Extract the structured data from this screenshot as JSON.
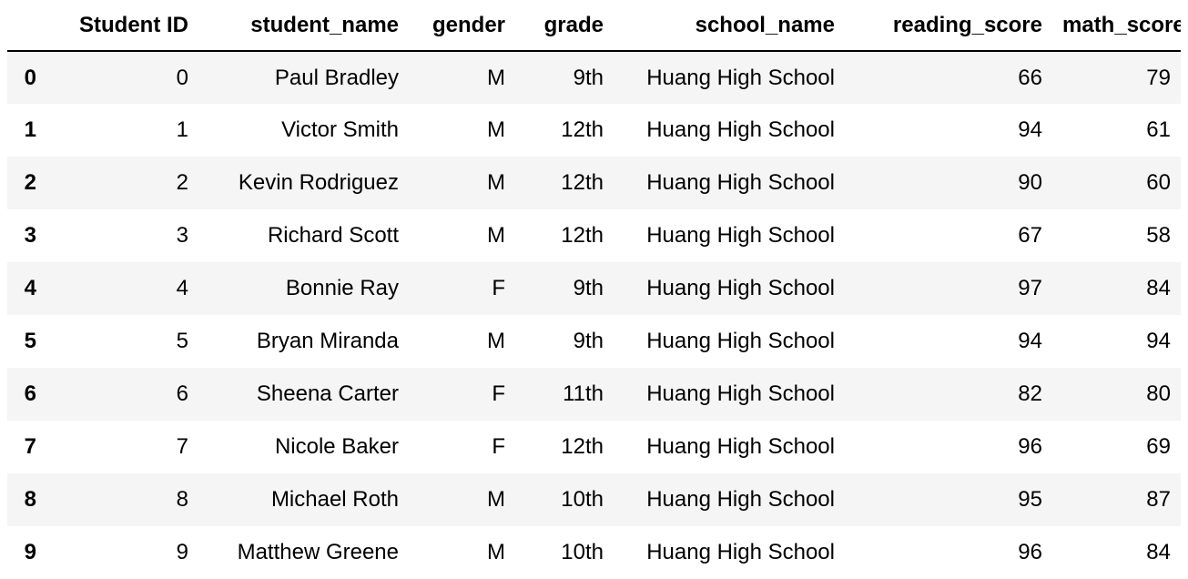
{
  "table": {
    "columns": [
      "",
      "Student ID",
      "student_name",
      "gender",
      "grade",
      "school_name",
      "reading_score",
      "math_score"
    ],
    "rows": [
      {
        "index": "0",
        "cells": [
          "0",
          "Paul Bradley",
          "M",
          "9th",
          "Huang High School",
          "66",
          "79"
        ]
      },
      {
        "index": "1",
        "cells": [
          "1",
          "Victor Smith",
          "M",
          "12th",
          "Huang High School",
          "94",
          "61"
        ]
      },
      {
        "index": "2",
        "cells": [
          "2",
          "Kevin Rodriguez",
          "M",
          "12th",
          "Huang High School",
          "90",
          "60"
        ]
      },
      {
        "index": "3",
        "cells": [
          "3",
          "Richard Scott",
          "M",
          "12th",
          "Huang High School",
          "67",
          "58"
        ]
      },
      {
        "index": "4",
        "cells": [
          "4",
          "Bonnie Ray",
          "F",
          "9th",
          "Huang High School",
          "97",
          "84"
        ]
      },
      {
        "index": "5",
        "cells": [
          "5",
          "Bryan Miranda",
          "M",
          "9th",
          "Huang High School",
          "94",
          "94"
        ]
      },
      {
        "index": "6",
        "cells": [
          "6",
          "Sheena Carter",
          "F",
          "11th",
          "Huang High School",
          "82",
          "80"
        ]
      },
      {
        "index": "7",
        "cells": [
          "7",
          "Nicole Baker",
          "F",
          "12th",
          "Huang High School",
          "96",
          "69"
        ]
      },
      {
        "index": "8",
        "cells": [
          "8",
          "Michael Roth",
          "M",
          "10th",
          "Huang High School",
          "95",
          "87"
        ]
      },
      {
        "index": "9",
        "cells": [
          "9",
          "Matthew Greene",
          "M",
          "10th",
          "Huang High School",
          "96",
          "84"
        ]
      }
    ]
  },
  "colors": {
    "stripe": "#f5f5f5",
    "background": "#ffffff",
    "text": "#000000",
    "header_rule": "#000000"
  }
}
